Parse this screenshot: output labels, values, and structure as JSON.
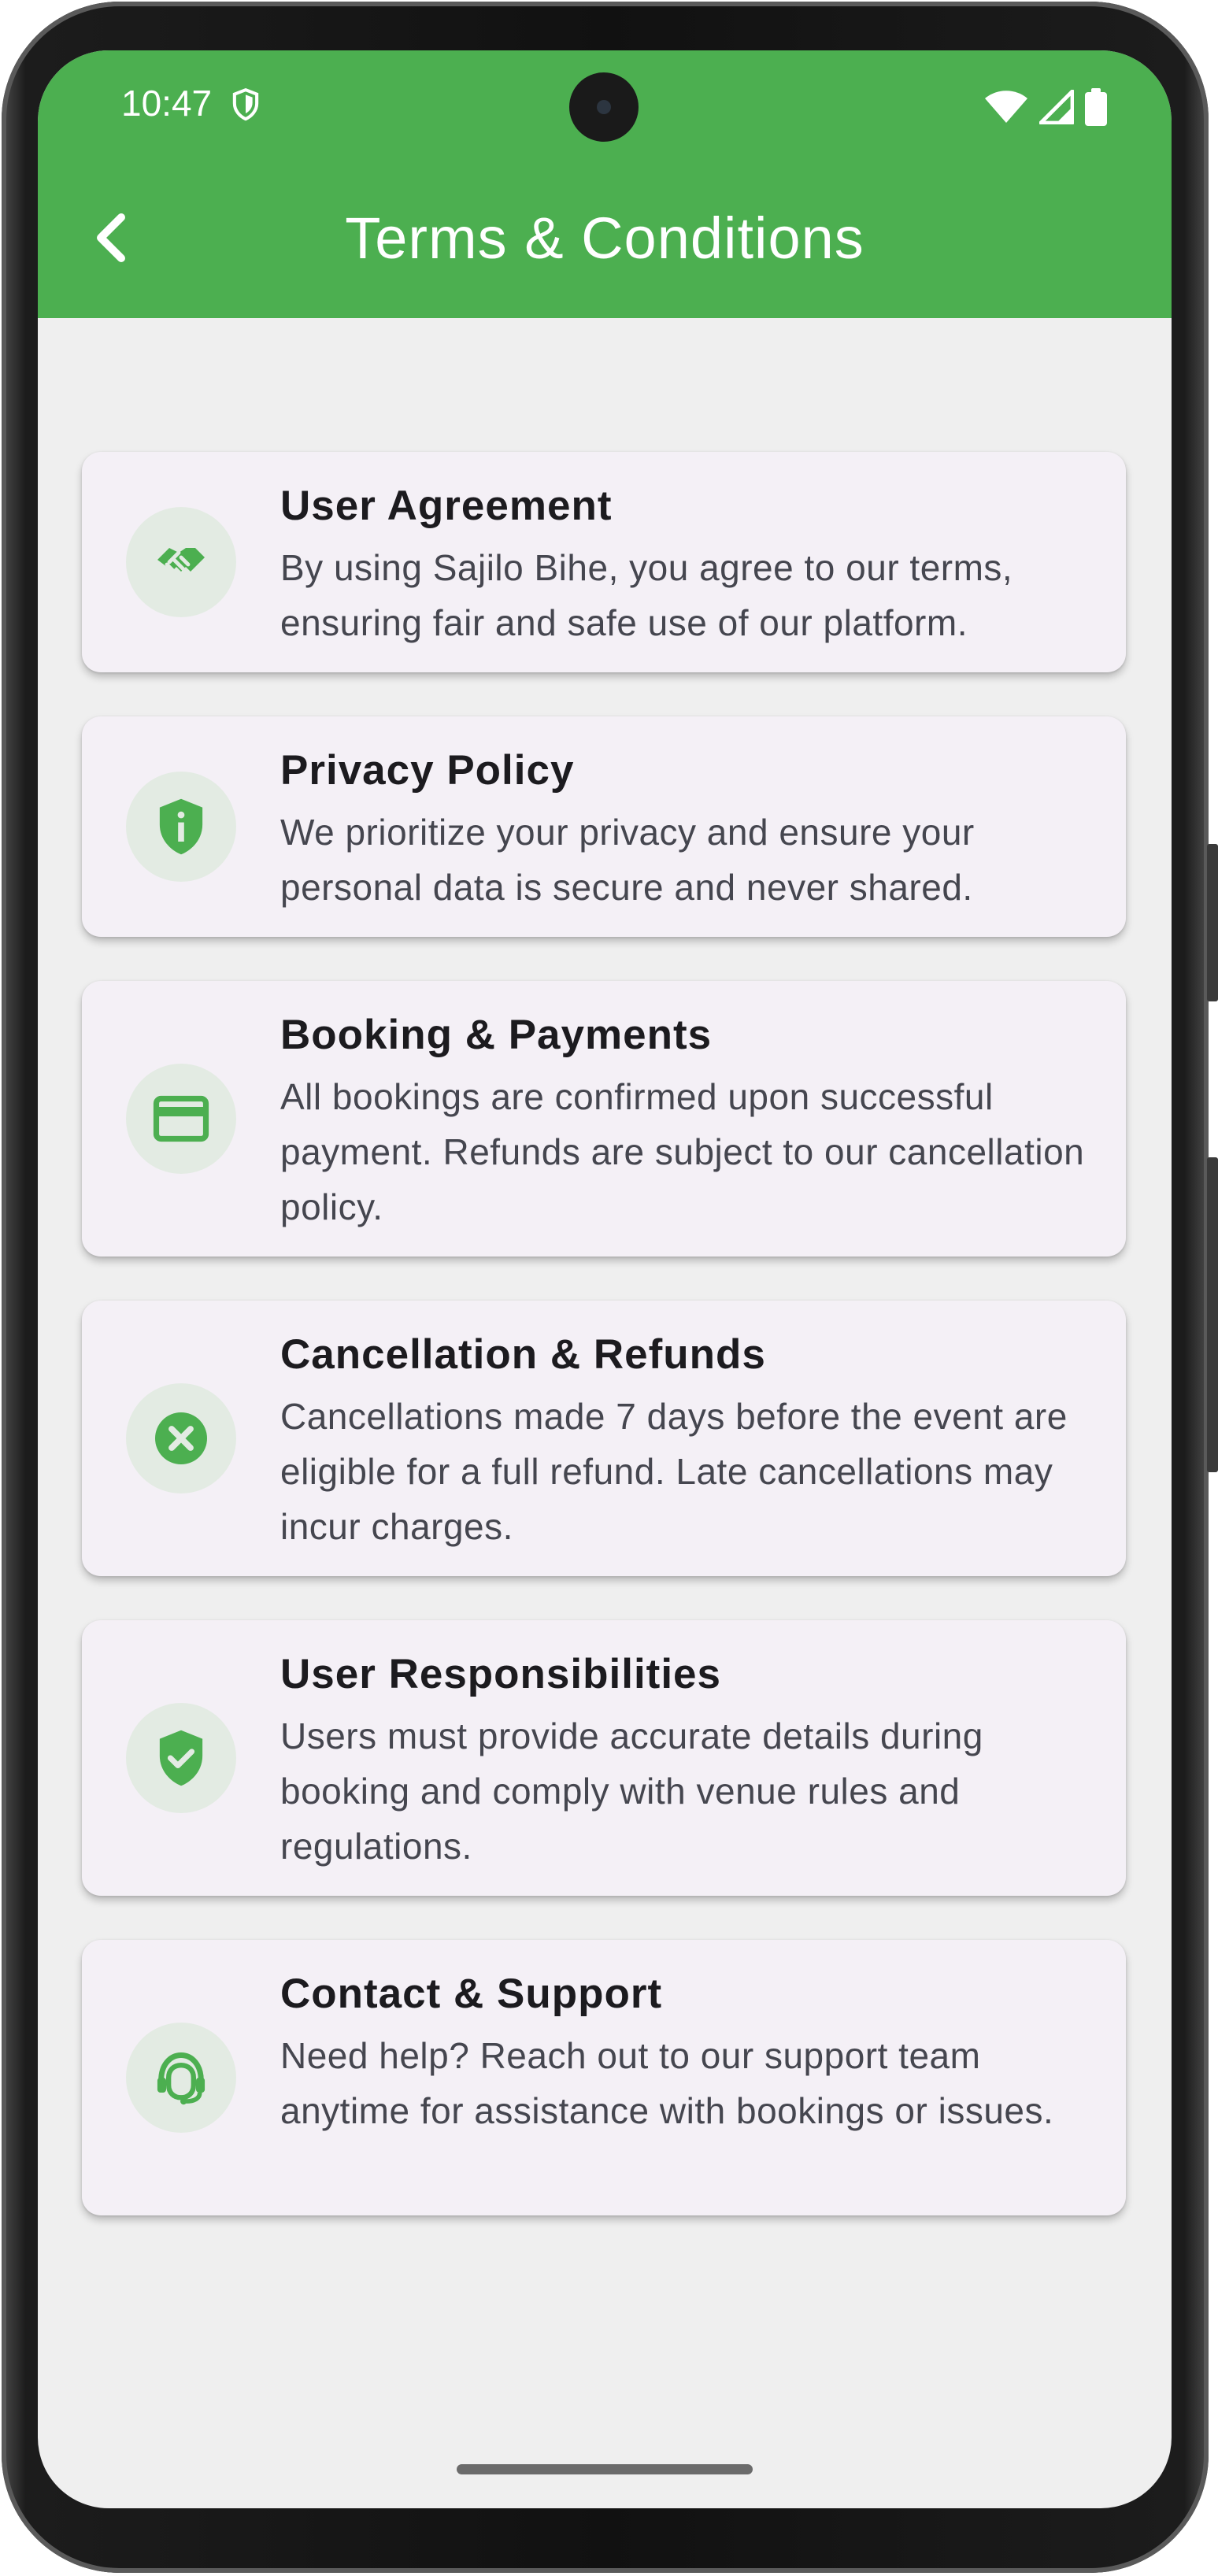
{
  "status_bar": {
    "time": "10:47"
  },
  "app_bar": {
    "title": "Terms & Conditions"
  },
  "colors": {
    "primary": "#4caf50",
    "background": "#efefef",
    "card": "#f4f0f6",
    "icon_circle": "#e3ebe3"
  },
  "cards": [
    {
      "icon": "handshake-icon",
      "title": "User Agreement",
      "desc": "By using Sajilo Bihe, you agree to our terms, ensuring fair and safe use of our platform."
    },
    {
      "icon": "privacy-shield-icon",
      "title": "Privacy Policy",
      "desc": "We prioritize your privacy and ensure your personal data is secure and never shared."
    },
    {
      "icon": "credit-card-icon",
      "title": "Booking & Payments",
      "desc": "All bookings are confirmed upon successful payment. Refunds are subject to our cancellation policy."
    },
    {
      "icon": "cancel-icon",
      "title": "Cancellation & Refunds",
      "desc": "Cancellations made 7 days before the event are eligible for a full refund. Late cancellations may incur charges."
    },
    {
      "icon": "verified-shield-icon",
      "title": "User Responsibilities",
      "desc": "Users must provide accurate details during booking and comply with venue rules and regulations."
    },
    {
      "icon": "support-agent-icon",
      "title": "Contact & Support",
      "desc": "Need help? Reach out to our support team anytime for assistance with bookings or issues."
    }
  ]
}
